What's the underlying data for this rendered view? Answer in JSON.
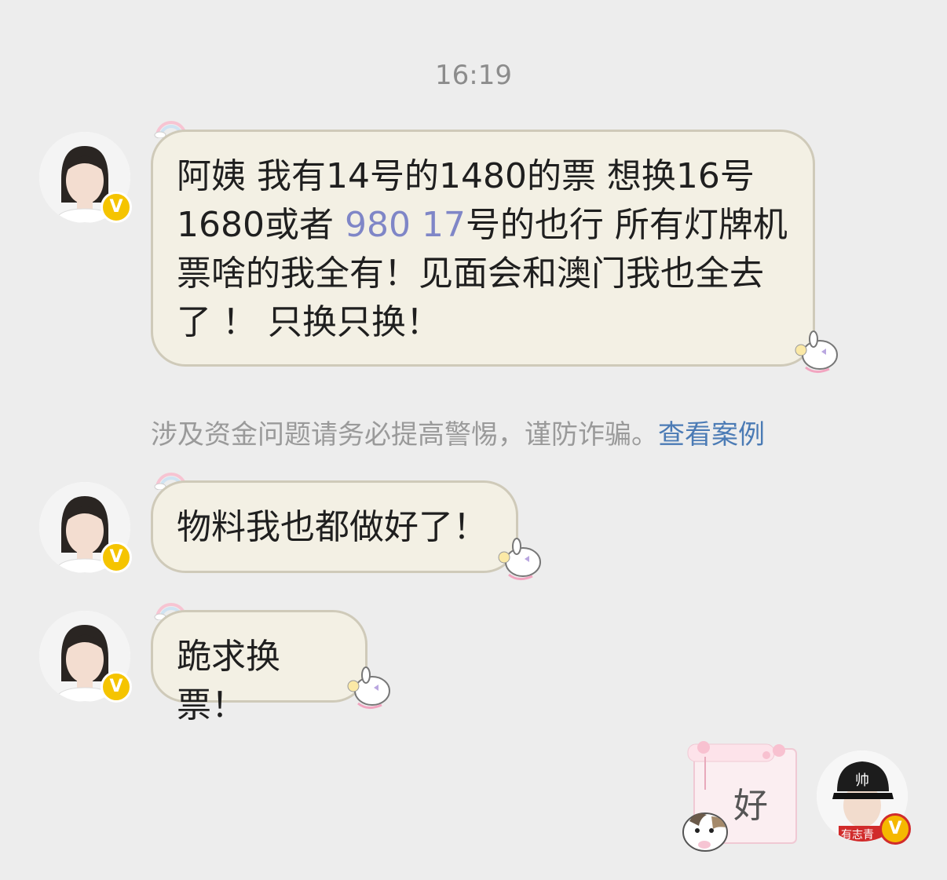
{
  "timestamp": "16:19",
  "messages": [
    {
      "text_parts": [
        "阿姨 我有14号的1480的票 想换16号1680或者 ",
        "980 17",
        "号的也行 所有灯牌机票啥的我全有！见面会和澳门我也全去了 ！ 只换只换！"
      ]
    },
    {
      "text": "物料我也都做好了！"
    },
    {
      "text": "跪求换票！"
    }
  ],
  "warning": {
    "text": "涉及资金问题请务必提高警惕，谨防诈骗。",
    "link": "查看案例"
  },
  "self_message": {
    "text": "好"
  },
  "self_avatar": {
    "hat_text": "帅",
    "tag_text": "有志青"
  },
  "icons": {
    "verified": "verified-v-badge",
    "sticker": "bunny-sticker",
    "rainbow": "rainbow-decoration"
  }
}
